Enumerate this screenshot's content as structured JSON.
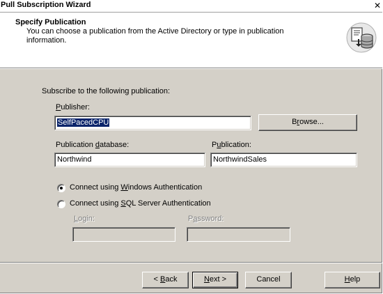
{
  "window": {
    "title": "Pull Subscription Wizard",
    "close_glyph": "✕"
  },
  "header": {
    "title": "Specify Publication",
    "description": "You can choose a publication from the Active Directory or type in publication information."
  },
  "form": {
    "intro": "Subscribe to the following publication:",
    "publisher": {
      "label_pre": "",
      "label_hot": "P",
      "label_post": "ublisher:",
      "value": "SelfPacedCPU"
    },
    "browse_button": {
      "label_pre": "B",
      "label_hot": "r",
      "label_post": "owse..."
    },
    "publication_database": {
      "label_pre": "Publication ",
      "label_hot": "d",
      "label_post": "atabase:",
      "value": "Northwind"
    },
    "publication": {
      "label_pre": "P",
      "label_hot": "u",
      "label_post": "blication:",
      "value": "NorthwindSales"
    },
    "auth_windows": {
      "label_pre": "Connect using ",
      "label_hot": "W",
      "label_post": "indows Authentication",
      "selected": true
    },
    "auth_sql": {
      "label_pre": "Connect using ",
      "label_hot": "S",
      "label_post": "QL Server Authentication",
      "selected": false
    },
    "login": {
      "label_pre": "",
      "label_hot": "L",
      "label_post": "ogin:",
      "value": ""
    },
    "password": {
      "label_pre": "P",
      "label_hot": "a",
      "label_post": "ssword:",
      "value": ""
    }
  },
  "buttons": {
    "back": {
      "label_pre": "< ",
      "label_hot": "B",
      "label_post": "ack"
    },
    "next": {
      "label_pre": "",
      "label_hot": "N",
      "label_post": "ext >"
    },
    "cancel": {
      "label": "Cancel"
    },
    "help": {
      "label_pre": "",
      "label_hot": "H",
      "label_post": "elp"
    }
  },
  "icons": {
    "header_icon": "publication-database-icon"
  }
}
